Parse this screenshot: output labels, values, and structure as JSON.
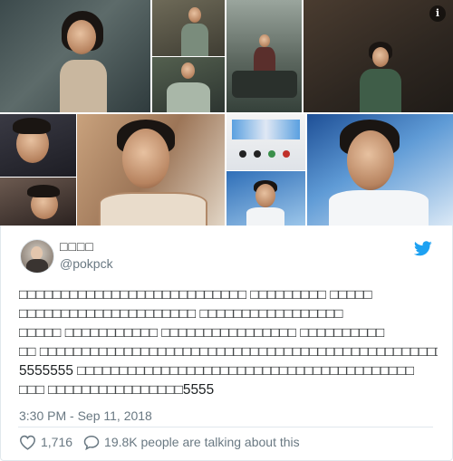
{
  "tweet": {
    "display_name": "□□□□",
    "handle": "@pokpck",
    "body_lines": [
      "□□□□□□□□□□□□□□□□□□□□□□□□□□□ □□□□□□□□□ □□□□□",
      "□□□□□□□□□□□□□□□□□□□□□ □□□□□□□□□□□□□□□□□",
      "□□□□□ □□□□□□□□□□□ □□□□□□□□□□□□□□□□ □□□□□□□□□□",
      "□□ □□□□□□□□□□□□□□□□□□□□□□□□□□□□□□□□□□□□□□□□□□□□□□□□□",
      "5555555 □□□□□□□□□□□□□□□□□□□□□□□□□□□□□□□□□□□□□□□□",
      "□□□ □□□□□□□□□□□□□□□□5555"
    ],
    "timestamp": "3:30 PM - Sep 11, 2018",
    "like_count": "1,716",
    "talking_text": "19.8K people are talking about this"
  },
  "icons": {
    "info": "info-icon",
    "brand": "twitter-bird-icon",
    "like": "heart-icon",
    "reply": "speech-bubble-icon"
  },
  "colors": {
    "brand_blue": "#1da1f2",
    "text_primary": "#1c2022",
    "text_secondary": "#697882",
    "border": "#e1e8ed"
  }
}
